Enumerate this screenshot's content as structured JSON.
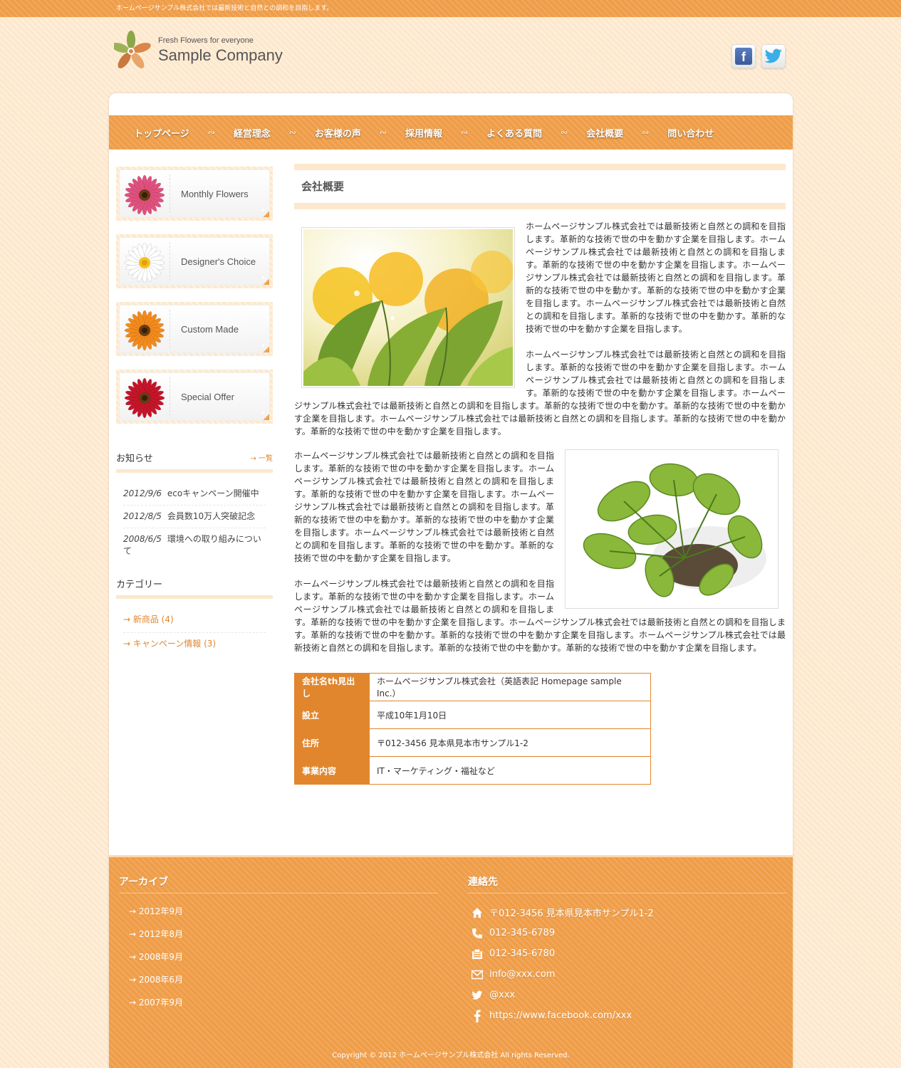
{
  "topbar": {
    "text": "ホームページサンプル株式会社では最新技術と自然との調和を目指します。"
  },
  "logo": {
    "tagline": "Fresh Flowers for everyone",
    "name": "Sample Company"
  },
  "social": {
    "facebook": "f"
  },
  "nav": {
    "items": [
      "トップページ",
      "経営理念",
      "お客様の声",
      "採用情報",
      "よくある質問",
      "会社概要",
      "問い合わせ"
    ],
    "separator": "∾"
  },
  "sidebar": {
    "banners": [
      {
        "label": "Monthly Flowers",
        "color": "#e0507e"
      },
      {
        "label": "Designer's Choice",
        "color": "#ffffff"
      },
      {
        "label": "Custom Made",
        "color": "#f28a1c"
      },
      {
        "label": "Special Offer",
        "color": "#c4152a"
      }
    ],
    "banner_arrow": "▸",
    "news": {
      "title": "お知らせ",
      "more": "→ 一覧",
      "items": [
        {
          "date": "2012/9/6",
          "text": "ecoキャンペーン開催中"
        },
        {
          "date": "2012/8/5",
          "text": "会員数10万人突破記念"
        },
        {
          "date": "2008/6/5",
          "text": "環境への取り組みについて"
        }
      ]
    },
    "categories": {
      "title": "カテゴリー",
      "items": [
        "→ 新商品 (4)",
        "→ キャンペーン情報 (3)"
      ]
    }
  },
  "main": {
    "title": "会社概要",
    "para1": "ホームページサンプル株式会社では最新技術と自然との調和を目指します。革新的な技術で世の中を動かす企業を目指します。ホームページサンプル株式会社では最新技術と自然との調和を目指します。革新的な技術で世の中を動かす企業を目指します。ホームページサンプル株式会社では最新技術と自然との調和を目指します。革新的な技術で世の中を動かす。革新的な技術で世の中を動かす企業を目指します。ホームページサンプル株式会社では最新技術と自然との調和を目指します。革新的な技術で世の中を動かす。革新的な技術で世の中を動かす企業を目指します。",
    "para2": "ホームページサンプル株式会社では最新技術と自然との調和を目指します。革新的な技術で世の中を動かす企業を目指します。ホームページサンプル株式会社では最新技術と自然との調和を目指します。革新的な技術で世の中を動かす企業を目指します。ホームページサンプル株式会社では最新技術と自然との調和を目指します。革新的な技術で世の中を動かす。革新的な技術で世の中を動かす企業を目指します。ホームページサンプル株式会社では最新技術と自然との調和を目指します。革新的な技術で世の中を動かす。革新的な技術で世の中を動かす企業を目指します。",
    "para3": "ホームページサンプル株式会社では最新技術と自然との調和を目指します。革新的な技術で世の中を動かす企業を目指します。ホームページサンプル株式会社では最新技術と自然との調和を目指します。革新的な技術で世の中を動かす企業を目指します。ホームページサンプル株式会社では最新技術と自然との調和を目指します。革新的な技術で世の中を動かす。革新的な技術で世の中を動かす企業を目指します。ホームページサンプル株式会社では最新技術と自然との調和を目指します。革新的な技術で世の中を動かす。革新的な技術で世の中を動かす企業を目指します。",
    "para4": "ホームページサンプル株式会社では最新技術と自然との調和を目指します。革新的な技術で世の中を動かす企業を目指します。ホームページサンプル株式会社では最新技術と自然との調和を目指します。革新的な技術で世の中を動かす企業を目指します。ホームページサンプル株式会社では最新技術と自然との調和を目指します。革新的な技術で世の中を動かす。革新的な技術で世の中を動かす企業を目指します。ホームページサンプル株式会社では最新技術と自然との調和を目指します。革新的な技術で世の中を動かす。革新的な技術で世の中を動かす企業を目指します。",
    "table": [
      {
        "th": "会社名th見出し",
        "td": "ホームページサンプル株式会社（英語表記 Homepage sample Inc.）"
      },
      {
        "th": "設立",
        "td": "平成10年1月10日"
      },
      {
        "th": "住所",
        "td": "〒012-3456 見本県見本市サンプル1-2"
      },
      {
        "th": "事業内容",
        "td": "IT・マーケティング・福祉など"
      }
    ]
  },
  "footer": {
    "archive_title": "アーカイブ",
    "archives": [
      "→ 2012年9月",
      "→ 2012年8月",
      "→ 2008年9月",
      "→ 2008年6月",
      "→ 2007年9月"
    ],
    "contact_title": "連絡先",
    "contacts": [
      {
        "icon": "home-icon",
        "text": "〒012-3456 見本県見本市サンプル1-2"
      },
      {
        "icon": "phone-icon",
        "text": "012-345-6789"
      },
      {
        "icon": "fax-icon",
        "text": "012-345-6780"
      },
      {
        "icon": "mail-icon",
        "text": "info@xxx.com"
      },
      {
        "icon": "twitter-icon",
        "text": "@xxx"
      },
      {
        "icon": "facebook-icon",
        "text": "https://www.facebook.com/xxx"
      }
    ],
    "copyright": "Copyright © 2012 ホームページサンプル株式会社 All rights Reserved."
  }
}
